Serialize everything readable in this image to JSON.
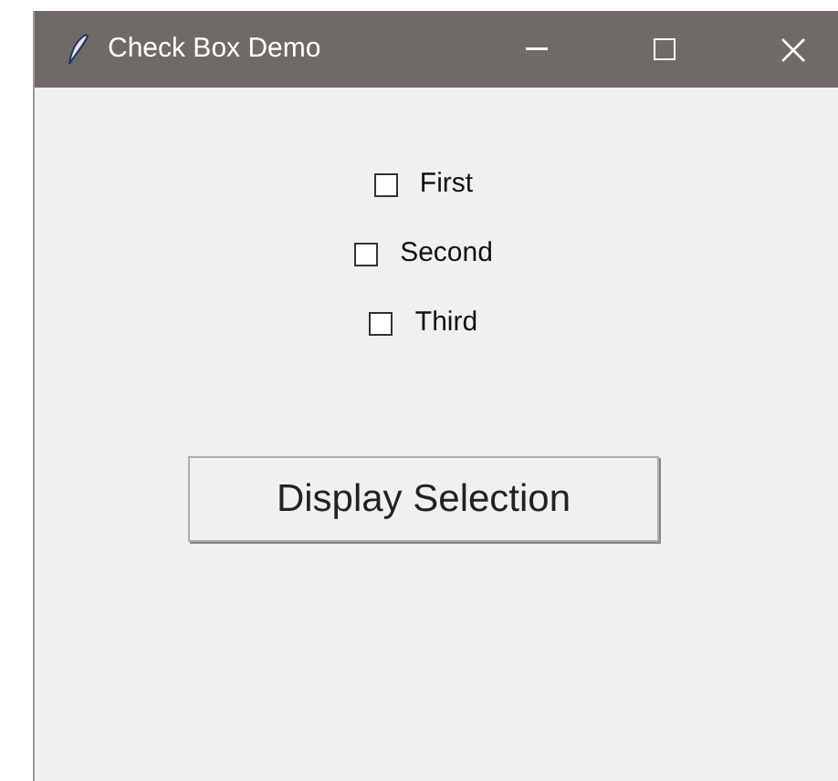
{
  "window": {
    "title": "Check Box Demo"
  },
  "checkboxes": [
    {
      "label": "First",
      "checked": false
    },
    {
      "label": "Second",
      "checked": false
    },
    {
      "label": "Third",
      "checked": false
    }
  ],
  "button": {
    "label": "Display Selection"
  }
}
